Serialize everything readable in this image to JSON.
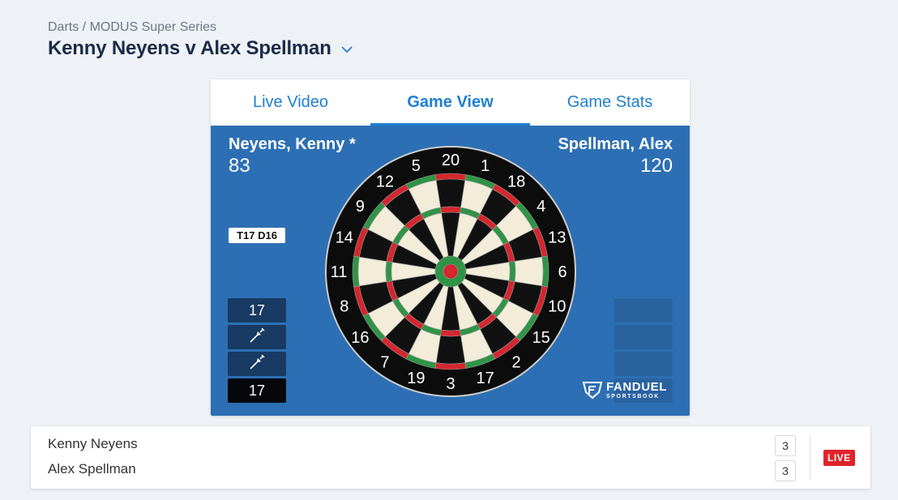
{
  "header": {
    "breadcrumb": "Darts / MODUS Super Series",
    "title": "Kenny Neyens v Alex Spellman",
    "title_chevron_icon": "chevron-down-icon"
  },
  "tabs": [
    {
      "label": "Live Video",
      "active": false
    },
    {
      "label": "Game View",
      "active": true
    },
    {
      "label": "Game Stats",
      "active": false
    }
  ],
  "game": {
    "player1": {
      "name": "Neyens, Kenny *",
      "score": "83",
      "checkout": "T17 D16",
      "throws": [
        {
          "type": "text",
          "value": "17",
          "style": "dark"
        },
        {
          "type": "icon",
          "value": "dart-icon",
          "style": "dark"
        },
        {
          "type": "icon",
          "value": "dart-icon",
          "style": "dark"
        },
        {
          "type": "text",
          "value": "17",
          "style": "black"
        }
      ]
    },
    "player2": {
      "name": "Spellman, Alex",
      "score": "120",
      "throws": [
        {
          "type": "empty"
        },
        {
          "type": "empty"
        },
        {
          "type": "empty"
        },
        {
          "type": "empty"
        }
      ]
    },
    "board_numbers": [
      "20",
      "1",
      "18",
      "4",
      "13",
      "6",
      "10",
      "15",
      "2",
      "17",
      "3",
      "19",
      "7",
      "16",
      "8",
      "11",
      "14",
      "9",
      "12",
      "5"
    ],
    "logo": {
      "brand": "FANDUEL",
      "sub": "SPORTSBOOK"
    }
  },
  "scoreboard": {
    "players": [
      {
        "name": "Kenny Neyens",
        "sets": "3"
      },
      {
        "name": "Alex Spellman",
        "sets": "3"
      }
    ],
    "status": "LIVE"
  },
  "colors": {
    "background": "#eef1f6",
    "accent_blue": "#1f7fd1",
    "game_blue": "#2d6fb4",
    "title": "#1b2b47",
    "live_red": "#e0232b",
    "board_red": "#d6262e",
    "board_green": "#2f9446",
    "board_cream": "#f2ecd9"
  }
}
